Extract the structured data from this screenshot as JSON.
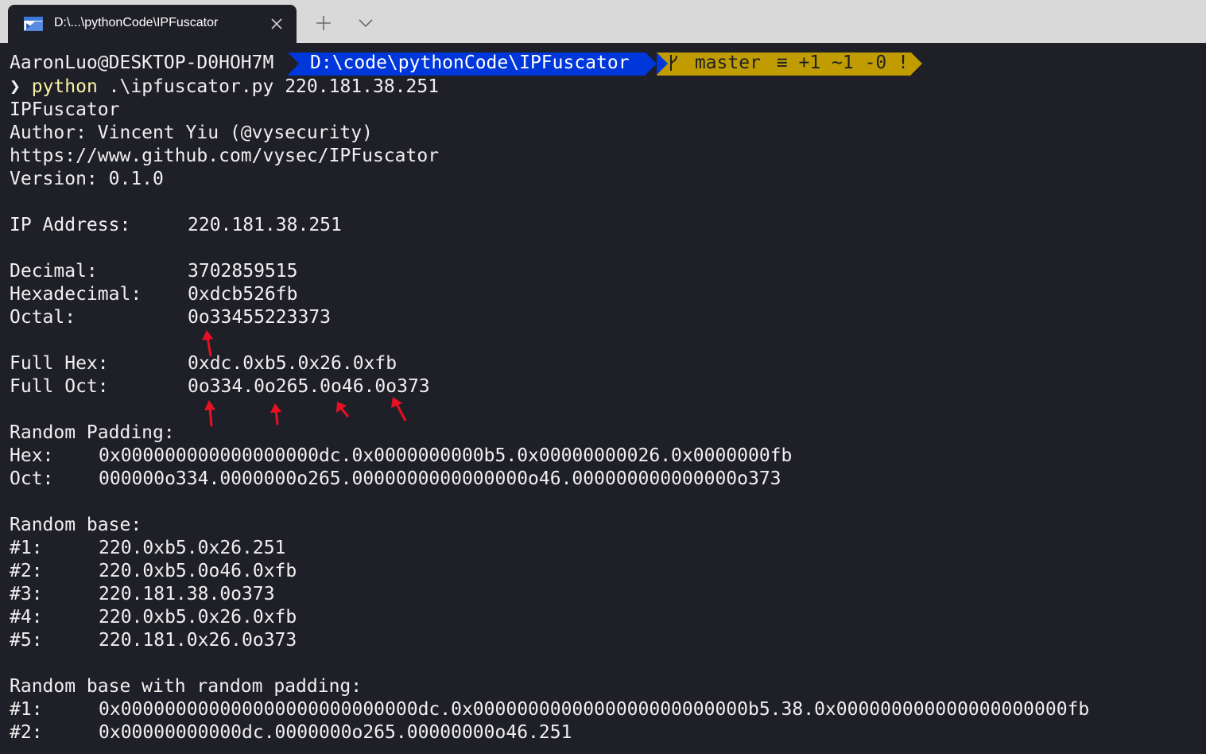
{
  "tab": {
    "title": "D:\\...\\pythonCode\\IPFuscator",
    "icon": "terminal-icon",
    "close_icon": "close-icon",
    "new_tab_icon": "plus-icon",
    "dropdown_icon": "chevron-down-icon"
  },
  "prompt": {
    "user": "AaronLuo@DESKTOP-D0HOH7M",
    "path": "D:\\code\\pythonCode\\IPFuscator",
    "branch_icon": "git-branch-icon",
    "branch": "master",
    "status": "≡ +1 ~1 -0 !",
    "colors": {
      "path_bg": "#0037da",
      "git_bg": "#c19c00",
      "bg": "#1f1f27"
    }
  },
  "command": {
    "chevron": "❯",
    "program": "python",
    "args": " .\\ipfuscator.py 220.181.38.251"
  },
  "output": {
    "header": [
      "IPFuscator",
      "Author: Vincent Yiu (@vysecurity)",
      "https://www.github.com/vysec/IPFuscator",
      "Version: 0.1.0"
    ],
    "ip_label": "IP Address:",
    "ip_value": "220.181.38.251",
    "decimal_label": "Decimal:",
    "decimal_value": "3702859515",
    "hex_label": "Hexadecimal:",
    "hex_value": "0xdcb526fb",
    "octal_label": "Octal:",
    "octal_value": "0o33455223373",
    "full_hex_label": "Full Hex:",
    "full_hex_value": "0xdc.0xb5.0x26.0xfb",
    "full_oct_label": "Full Oct:",
    "full_oct_value": "0o334.0o265.0o46.0o373",
    "random_padding_label": "Random Padding:",
    "rp_hex_label": "Hex:",
    "rp_hex_value": "0x000000000000000000dc.0x0000000000b5.0x00000000026.0x0000000fb",
    "rp_oct_label": "Oct:",
    "rp_oct_value": "000000o334.0000000o265.0000000000000000o46.000000000000000o373",
    "random_base_label": "Random base:",
    "random_base": [
      {
        "label": "#1:",
        "value": "220.0xb5.0x26.251"
      },
      {
        "label": "#2:",
        "value": "220.0xb5.0o46.0xfb"
      },
      {
        "label": "#3:",
        "value": "220.181.38.0o373"
      },
      {
        "label": "#4:",
        "value": "220.0xb5.0x26.0xfb"
      },
      {
        "label": "#5:",
        "value": "220.181.0x26.0o373"
      }
    ],
    "random_base_padding_label": "Random base with random padding:",
    "random_base_padding": [
      {
        "label": "#1:",
        "value": "0x000000000000000000000000000dc.0x0000000000000000000000000b5.38.0x000000000000000000000fb"
      },
      {
        "label": "#2:",
        "value": "0x00000000000dc.0000000o265.00000000o46.251"
      }
    ]
  },
  "annotation": {
    "arrow_color": "#e81123",
    "arrow_icon": "red-arrow-icon"
  }
}
